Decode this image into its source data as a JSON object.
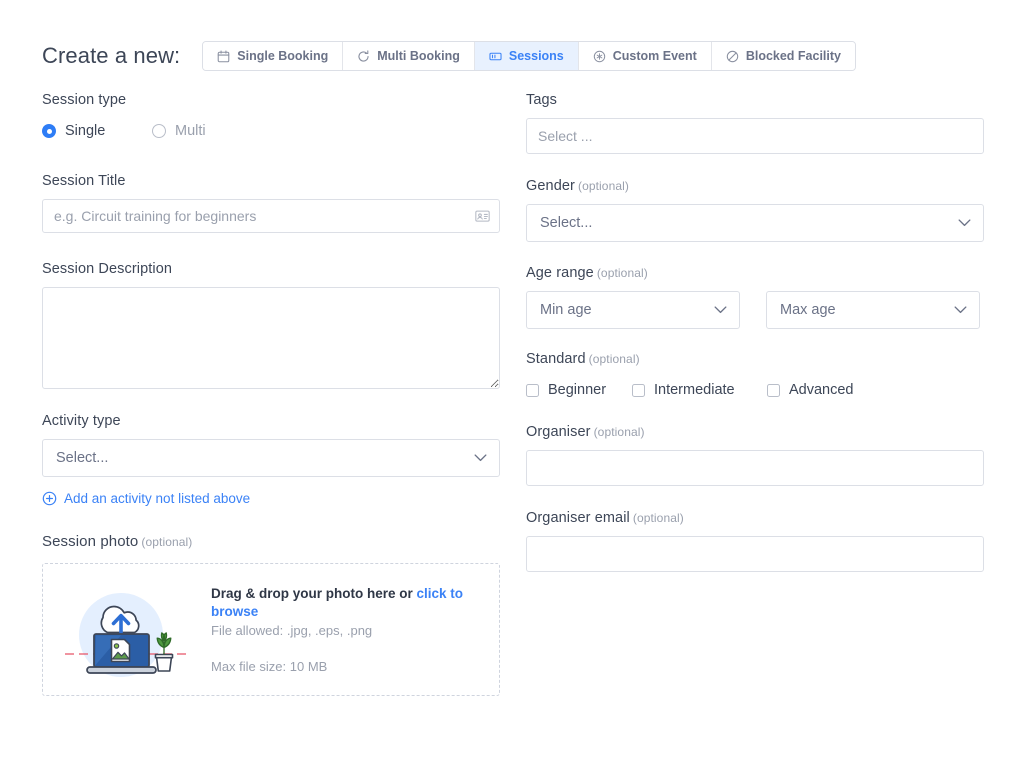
{
  "header": {
    "title": "Create a new:",
    "tabs": [
      {
        "label": "Single Booking",
        "icon": "calendar-icon",
        "active": false
      },
      {
        "label": "Multi Booking",
        "icon": "refresh-icon",
        "active": false
      },
      {
        "label": "Sessions",
        "icon": "ticket-icon",
        "active": true
      },
      {
        "label": "Custom Event",
        "icon": "star-circle-icon",
        "active": false
      },
      {
        "label": "Blocked Facility",
        "icon": "blocked-icon",
        "active": false
      }
    ]
  },
  "left": {
    "session_type": {
      "label": "Session type",
      "options": [
        {
          "label": "Single",
          "selected": true
        },
        {
          "label": "Multi",
          "selected": false
        }
      ]
    },
    "session_title": {
      "label": "Session Title",
      "placeholder": "e.g. Circuit training for beginners",
      "value": "",
      "icon": "contact-card-icon"
    },
    "session_description": {
      "label": "Session Description",
      "value": "",
      "placeholder": ""
    },
    "activity_type": {
      "label": "Activity type",
      "value": "Select...",
      "icon": "chevron-down-icon"
    },
    "add_activity_link": {
      "label": "Add an activity not listed above",
      "icon": "plus-circle-icon"
    },
    "session_photo": {
      "label": "Session photo",
      "optional": "(optional)",
      "drag_text": "Drag & drop your photo here or ",
      "browse_link": "click to browse",
      "file_allowed": "File allowed: .jpg, .eps, .png",
      "max_size": "Max file size: 10 MB",
      "illustration": "cloud-upload-laptop-illustration"
    }
  },
  "right": {
    "tags": {
      "label": "Tags",
      "placeholder": "Select ...",
      "value": ""
    },
    "gender": {
      "label": "Gender",
      "optional": "(optional)",
      "value": "Select...",
      "icon": "chevron-down-icon"
    },
    "age_range": {
      "label": "Age range",
      "optional": "(optional)",
      "min": "Min age",
      "max": "Max age"
    },
    "standard": {
      "label": "Standard",
      "optional": "(optional)",
      "options": [
        {
          "label": "Beginner",
          "checked": false
        },
        {
          "label": "Intermediate",
          "checked": false
        },
        {
          "label": "Advanced",
          "checked": false
        }
      ]
    },
    "organiser": {
      "label": "Organiser",
      "optional": "(optional)",
      "value": "",
      "placeholder": ""
    },
    "organiser_email": {
      "label": "Organiser email",
      "optional": "(optional)",
      "value": "",
      "placeholder": ""
    }
  },
  "colors": {
    "accent": "#3b82f6",
    "active_tab_bg": "#e8f1fe",
    "text": "#3d4657",
    "muted": "#9aa0ad",
    "border": "#dcdfe6"
  }
}
